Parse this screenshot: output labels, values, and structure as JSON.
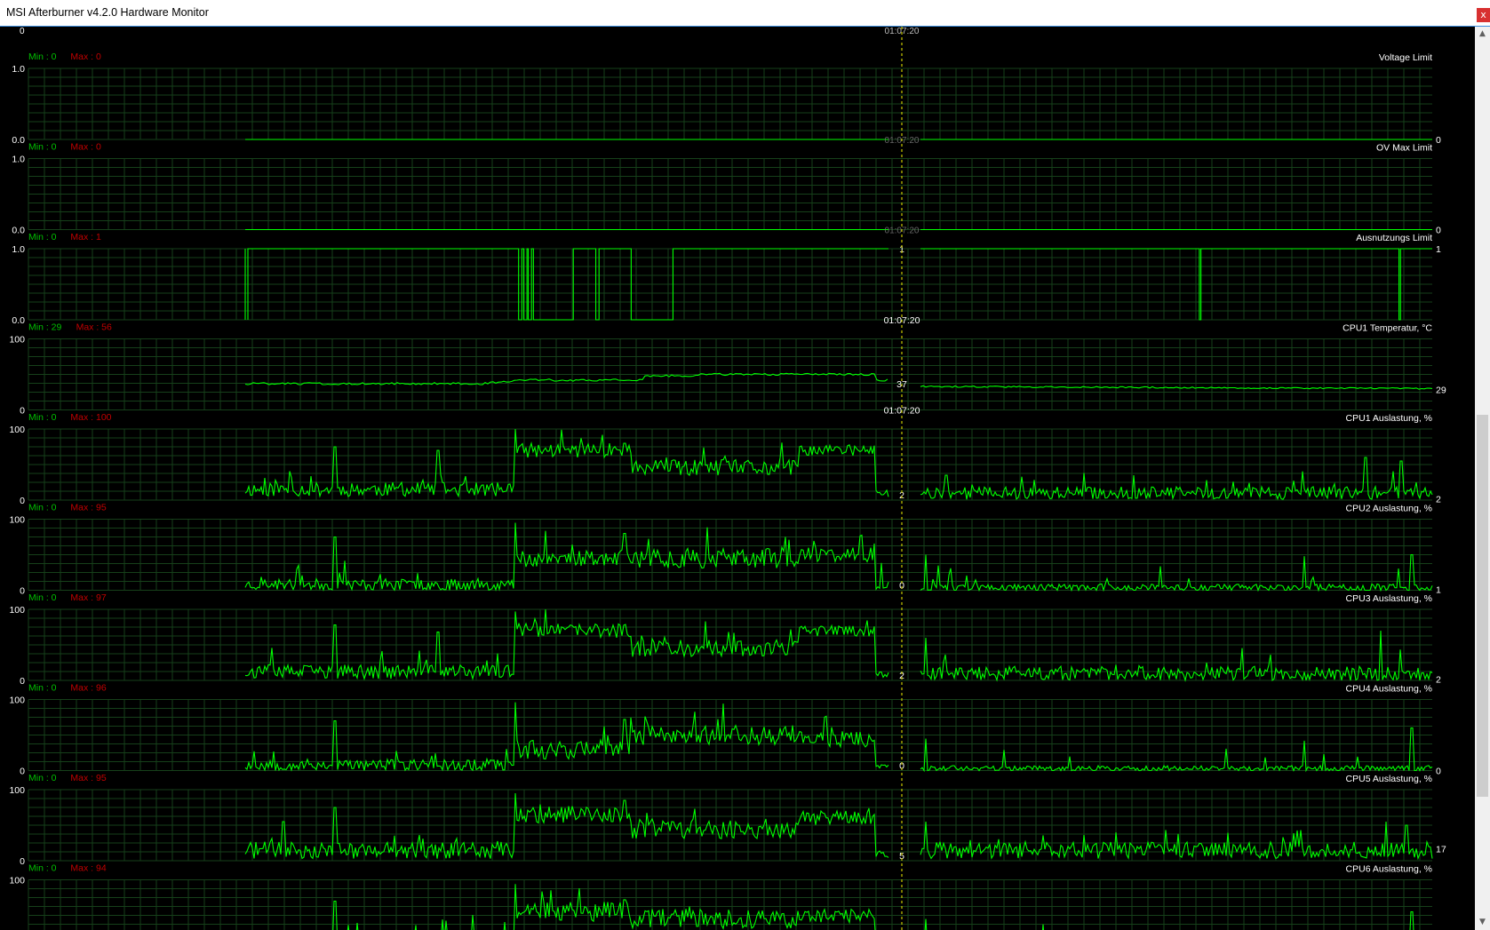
{
  "window": {
    "title": "MSI Afterburner v4.2.0 Hardware Monitor",
    "close_glyph": "x"
  },
  "scrollbar": {
    "up_glyph": "▲",
    "down_glyph": "▼"
  },
  "cursor_time": "01:07:20",
  "top_clipped": {
    "left_value": "0",
    "cursor_value": "01:07:20"
  },
  "colors": {
    "background": "#000000",
    "grid": "#16401a",
    "line": "#00ff00",
    "min_text": "#00c000",
    "max_text": "#c00000",
    "cursor_line": "#c8c800",
    "label_text": "#ffffff"
  },
  "panels": [
    {
      "name": "Voltage Limit",
      "min_label": "Min : 0",
      "max_label": "Max : 0",
      "y_top": "1.0",
      "y_bottom": "0.0",
      "ymax": 1,
      "current": "0",
      "cursor_value": "01:07:20",
      "cursor_style": "hidden",
      "type": "flat",
      "level": 0
    },
    {
      "name": "OV Max Limit",
      "min_label": "Min : 0",
      "max_label": "Max : 0",
      "y_top": "1.0",
      "y_bottom": "0.0",
      "ymax": 1,
      "current": "0",
      "cursor_value": "01:07:20",
      "cursor_style": "hidden",
      "type": "flat",
      "level": 0
    },
    {
      "name": "Ausnutzungs Limit",
      "min_label": "Min : 0",
      "max_label": "Max : 1",
      "y_top": "1.0",
      "y_bottom": "0.0",
      "ymax": 1,
      "current": "1",
      "cursor_value": "1",
      "cursor_time": "01:07:20",
      "cursor_style": "value_time",
      "type": "step",
      "transitions": [
        0.0,
        0.3,
        0.43,
        0.77,
        0.83,
        0.85,
        0.865,
        0.87,
        0.885,
        0.89,
        0.905,
        0.908,
        0.95,
        0.95,
        1.15,
        1.15,
        1.205,
        1.21,
        1.255,
        1.255,
        1.37,
        1.37,
        1.64,
        1.64,
        1.73,
        1.74,
        1.82,
        1.82,
        1.88,
        1.885,
        1.9
      ]
    },
    {
      "name": "CPU1 Temperatur, °C",
      "min_label": "Min : 29",
      "max_label": "Max : 56",
      "y_top": "100",
      "y_bottom": "0",
      "ymax": 100,
      "current": "29",
      "cursor_value": "37",
      "cursor_time": "01:07:20",
      "cursor_style": "value_time",
      "type": "temp",
      "segments": [
        [
          0.0,
          0.37,
          37
        ],
        [
          0.37,
          0.44,
          35
        ],
        [
          0.44,
          0.62,
          42
        ],
        [
          0.62,
          0.7,
          48
        ],
        [
          0.7,
          1.0,
          50
        ]
      ],
      "right_segments": [
        [
          0.0,
          0.25,
          34
        ],
        [
          0.25,
          1.0,
          31
        ]
      ]
    },
    {
      "name": "CPU1 Auslastung, %",
      "min_label": "Min : 0",
      "max_label": "Max : 100",
      "y_top": "100",
      "y_bottom": "0",
      "ymax": 100,
      "current": "2",
      "cursor_value": "2",
      "cursor_style": "value_overlap",
      "type": "load",
      "seed": 11,
      "left_phases": [
        [
          0.0,
          0.42,
          15,
          10
        ],
        [
          0.42,
          0.6,
          70,
          10
        ],
        [
          0.6,
          0.86,
          45,
          12
        ],
        [
          0.86,
          0.98,
          70,
          8
        ],
        [
          0.98,
          1.0,
          10,
          5
        ]
      ],
      "right_mean": 10,
      "right_amp": 9,
      "spikes_left": [
        [
          0.14,
          75
        ],
        [
          0.3,
          70
        ],
        [
          0.42,
          100
        ],
        [
          0.59,
          80
        ]
      ],
      "spikes_right": [
        [
          0.05,
          35
        ],
        [
          0.87,
          60
        ],
        [
          0.94,
          55
        ]
      ]
    },
    {
      "name": "CPU2 Auslastung, %",
      "min_label": "Min : 0",
      "max_label": "Max : 95",
      "y_top": "100",
      "y_bottom": "0",
      "ymax": 100,
      "current": "1",
      "cursor_value": "0",
      "cursor_style": "value_overlap",
      "type": "load",
      "seed": 23,
      "left_phases": [
        [
          0.0,
          0.42,
          8,
          8
        ],
        [
          0.42,
          0.6,
          45,
          12
        ],
        [
          0.6,
          0.86,
          45,
          14
        ],
        [
          0.86,
          0.98,
          50,
          10
        ],
        [
          0.98,
          1.0,
          5,
          4
        ]
      ],
      "right_mean": 4,
      "right_amp": 5,
      "spikes_left": [
        [
          0.14,
          75
        ],
        [
          0.42,
          95
        ],
        [
          0.59,
          80
        ],
        [
          0.84,
          75
        ]
      ],
      "spikes_right": [
        [
          0.01,
          50
        ],
        [
          0.75,
          48
        ],
        [
          0.96,
          50
        ]
      ]
    },
    {
      "name": "CPU3 Auslastung, %",
      "min_label": "Min : 0",
      "max_label": "Max : 97",
      "y_top": "100",
      "y_bottom": "0",
      "ymax": 100,
      "current": "2",
      "cursor_value": "2",
      "cursor_style": "value_overlap",
      "type": "load",
      "seed": 37,
      "left_phases": [
        [
          0.0,
          0.42,
          12,
          10
        ],
        [
          0.42,
          0.6,
          70,
          10
        ],
        [
          0.6,
          0.86,
          45,
          12
        ],
        [
          0.86,
          0.98,
          70,
          8
        ],
        [
          0.98,
          1.0,
          8,
          5
        ]
      ],
      "right_mean": 10,
      "right_amp": 10,
      "spikes_left": [
        [
          0.14,
          78
        ],
        [
          0.3,
          68
        ],
        [
          0.42,
          97
        ]
      ],
      "spikes_right": [
        [
          0.01,
          60
        ],
        [
          0.9,
          70
        ]
      ]
    },
    {
      "name": "CPU4 Auslastung, %",
      "min_label": "Min : 0",
      "max_label": "Max : 96",
      "y_top": "100",
      "y_bottom": "0",
      "ymax": 100,
      "current": "0",
      "cursor_value": "0",
      "cursor_style": "value_overlap",
      "type": "load",
      "seed": 53,
      "left_phases": [
        [
          0.0,
          0.42,
          8,
          8
        ],
        [
          0.42,
          0.6,
          30,
          14
        ],
        [
          0.6,
          0.86,
          50,
          14
        ],
        [
          0.86,
          0.98,
          45,
          12
        ],
        [
          0.98,
          1.0,
          5,
          4
        ]
      ],
      "right_mean": 3,
      "right_amp": 4,
      "spikes_left": [
        [
          0.14,
          70
        ],
        [
          0.42,
          96
        ],
        [
          0.59,
          72
        ]
      ],
      "spikes_right": [
        [
          0.01,
          45
        ],
        [
          0.75,
          42
        ],
        [
          0.96,
          60
        ]
      ]
    },
    {
      "name": "CPU5 Auslastung, %",
      "min_label": "Min : 0",
      "max_label": "Max : 95",
      "y_top": "100",
      "y_bottom": "0",
      "ymax": 100,
      "current": "17",
      "cursor_value": "5",
      "cursor_style": "value_overlap",
      "type": "load",
      "seed": 71,
      "left_phases": [
        [
          0.0,
          0.42,
          15,
          12
        ],
        [
          0.42,
          0.6,
          65,
          12
        ],
        [
          0.6,
          0.86,
          45,
          14
        ],
        [
          0.86,
          0.98,
          60,
          10
        ],
        [
          0.98,
          1.0,
          10,
          5
        ]
      ],
      "right_mean": 15,
      "right_amp": 12,
      "spikes_left": [
        [
          0.06,
          55
        ],
        [
          0.14,
          75
        ],
        [
          0.42,
          95
        ],
        [
          0.59,
          85
        ]
      ],
      "spikes_right": [
        [
          0.01,
          55
        ],
        [
          0.91,
          55
        ],
        [
          0.95,
          50
        ]
      ]
    },
    {
      "name": "CPU6 Auslastung, %",
      "min_label": "Min : 0",
      "max_label": "Max : 94",
      "y_top": "100",
      "y_bottom": "",
      "ymax": 100,
      "current": "",
      "cursor_value": "",
      "cursor_style": "hidden",
      "type": "load",
      "seed": 89,
      "left_phases": [
        [
          0.0,
          0.42,
          12,
          10
        ],
        [
          0.42,
          0.6,
          55,
          14
        ],
        [
          0.6,
          0.86,
          45,
          14
        ],
        [
          0.86,
          0.98,
          50,
          10
        ],
        [
          0.98,
          1.0,
          6,
          5
        ]
      ],
      "right_mean": 8,
      "right_amp": 9,
      "spikes_left": [
        [
          0.14,
          70
        ],
        [
          0.42,
          94
        ],
        [
          0.59,
          72
        ]
      ],
      "spikes_right": [
        [
          0.01,
          45
        ],
        [
          0.96,
          55
        ]
      ]
    }
  ]
}
